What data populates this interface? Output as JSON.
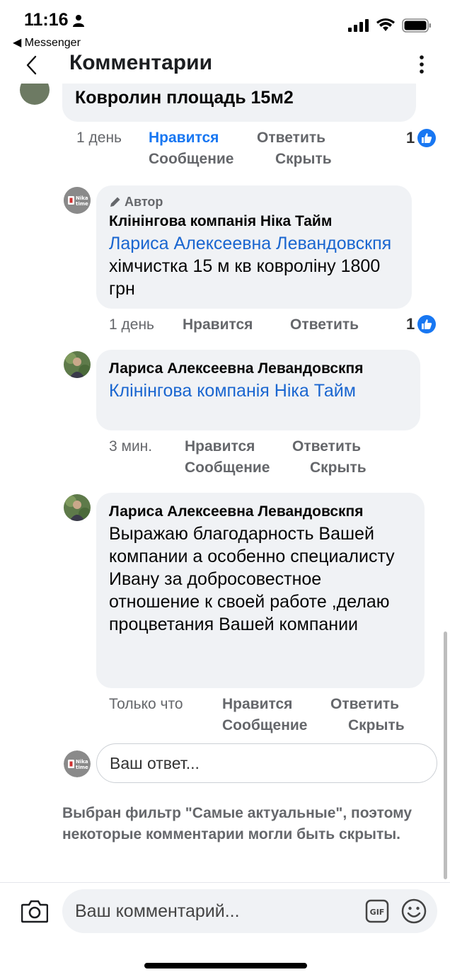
{
  "status": {
    "time": "11:16",
    "back_app": "◀ Messenger"
  },
  "header": {
    "title": "Комментарии"
  },
  "top_comment": {
    "partial_text": "Ковролин площадь 15м2",
    "time": "1 день",
    "like": "Нравится",
    "reply": "Ответить",
    "message": "Сообщение",
    "hide": "Скрыть",
    "reaction_count": "1"
  },
  "comments": [
    {
      "author_badge": "Автор",
      "author": "Клінінгова компанія Ніка Тайм",
      "mention": "Лариса Алексеевна Левандовскпя",
      "text": " хімчистка 15 м кв ковроліну 1800 грн",
      "time": "1 день",
      "like": "Нравится",
      "reply": "Ответить",
      "reaction_count": "1"
    },
    {
      "author": "Лариса Алексеевна Левандовскпя",
      "mention": "Клінінгова компанія Ніка Тайм",
      "time": "3 мин.",
      "like": "Нравится",
      "reply": "Ответить",
      "message": "Сообщение",
      "hide": "Скрыть"
    },
    {
      "author": "Лариса Алексеевна Левандовскпя",
      "text": "Выражаю благодарность Вашей компании а особенно специалисту Ивану за добросовестное отношение к своей работе  ,делаю процветания  Вашей компании",
      "time": "Только что",
      "like": "Нравится",
      "reply": "Ответить",
      "message": "Сообщение",
      "hide": "Скрыть"
    }
  ],
  "reply_box": {
    "placeholder": "Ваш ответ..."
  },
  "filter_note": "Выбран фильтр \"Самые актуальные\", поэтому некоторые комментарии могли быть скрыты.",
  "composer": {
    "placeholder": "Ваш комментарий...",
    "gif_label": "GIF"
  },
  "logo_text": "Nika time",
  "colors": {
    "accent": "#1877f2",
    "mention": "#1a66d0",
    "bubble": "#f0f2f5",
    "meta": "#65676b"
  }
}
